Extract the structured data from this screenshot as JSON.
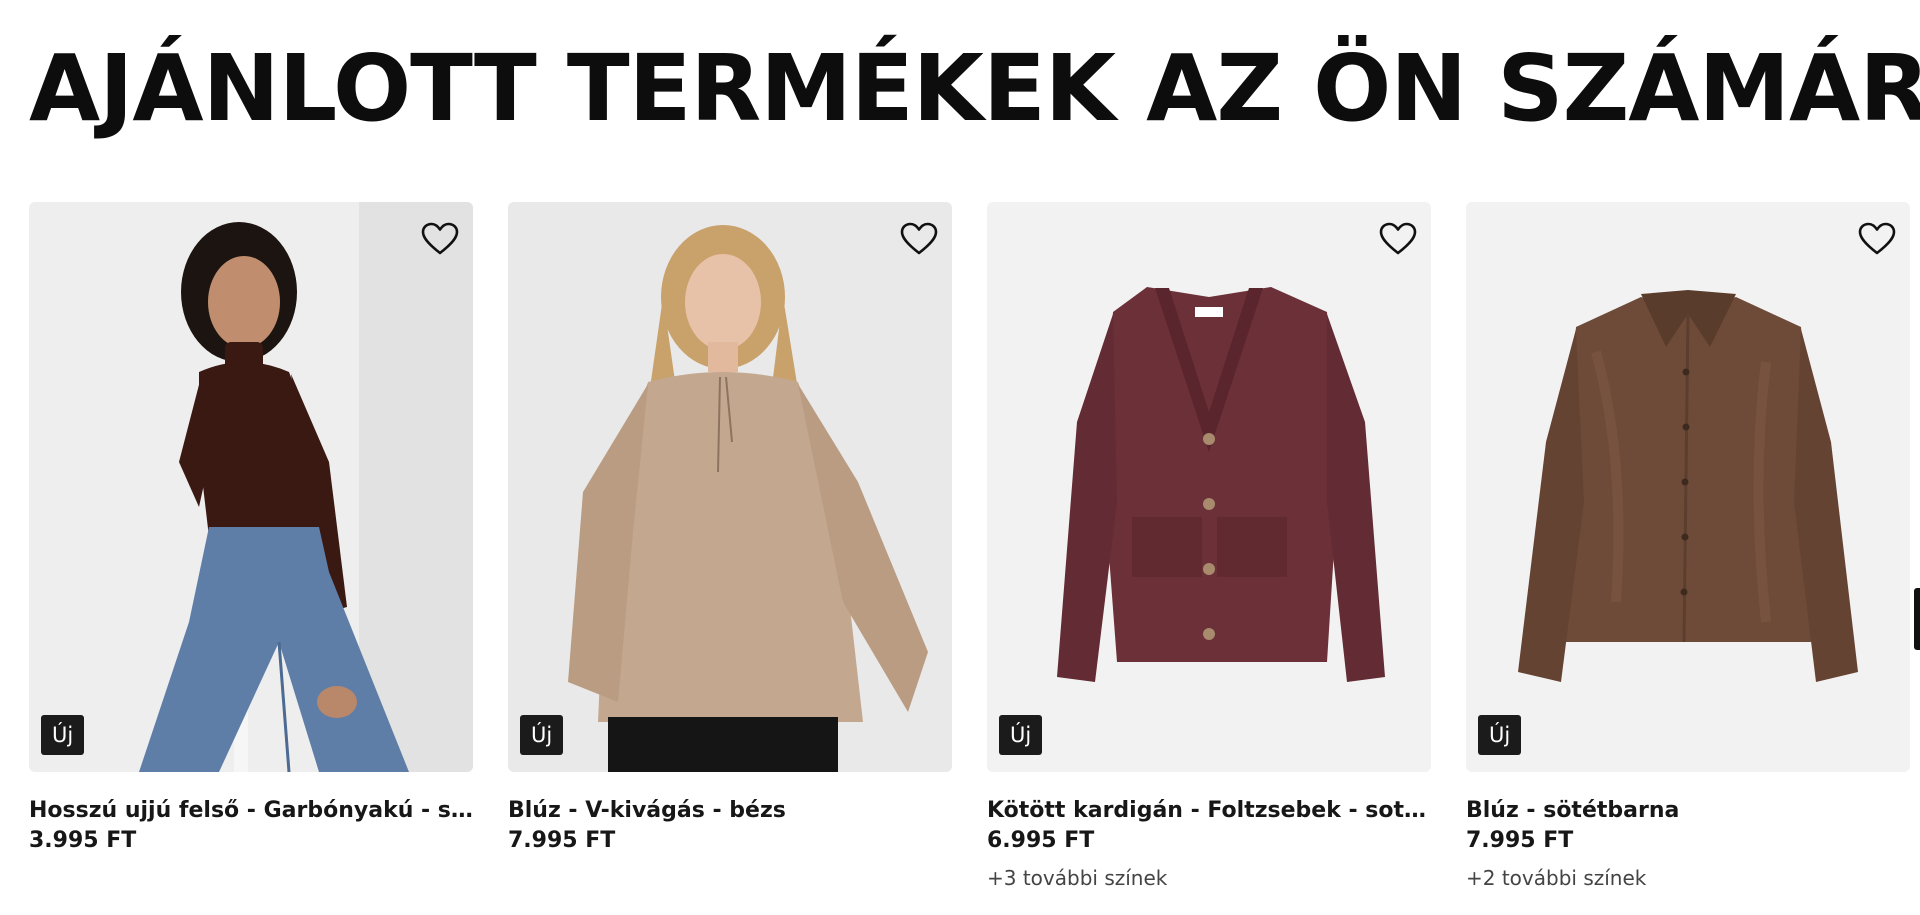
{
  "section": {
    "title": "AJÁNLOTT TERMÉKEK AZ ÖN SZÁMÁRA"
  },
  "products": [
    {
      "name": "Hosszú ujjú felső - Garbónyakú - sötétbarna",
      "price": "3.995 FT",
      "badge": "Új",
      "more_colors": "",
      "favorite_icon": "heart-outline-icon",
      "color": "#3a1a14"
    },
    {
      "name": "Blúz - V-kivágás - bézs",
      "price": "7.995 FT",
      "badge": "Új",
      "more_colors": "",
      "favorite_icon": "heart-outline-icon",
      "color": "#c2a58c"
    },
    {
      "name": "Kötött kardigán - Foltzsebek - sotetlila",
      "price": "6.995 FT",
      "badge": "Új",
      "more_colors": "+3 további színek",
      "favorite_icon": "heart-outline-icon",
      "color": "#6b3038"
    },
    {
      "name": "Blúz - sötétbarna",
      "price": "7.995 FT",
      "badge": "Új",
      "more_colors": "+2 további színek",
      "favorite_icon": "heart-outline-icon",
      "color": "#6e4b38"
    }
  ]
}
